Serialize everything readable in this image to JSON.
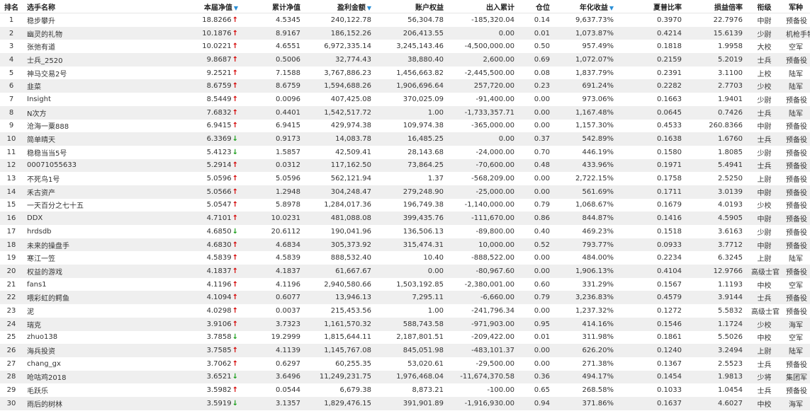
{
  "columns": [
    {
      "key": "rank",
      "label": "排名",
      "sort": false
    },
    {
      "key": "name",
      "label": "选手名称",
      "sort": false
    },
    {
      "key": "nav",
      "label": "本届净值",
      "sort": true
    },
    {
      "key": "cum_nav",
      "label": "累计净值",
      "sort": false
    },
    {
      "key": "profit",
      "label": "盈利金额",
      "sort": true
    },
    {
      "key": "equity",
      "label": "账户权益",
      "sort": false
    },
    {
      "key": "flow",
      "label": "出入累计",
      "sort": false
    },
    {
      "key": "position",
      "label": "仓位",
      "sort": false
    },
    {
      "key": "annual",
      "label": "年化收益",
      "sort": true
    },
    {
      "key": "sharpe",
      "label": "夏普比率",
      "sort": false
    },
    {
      "key": "pl_ratio",
      "label": "损益倍率",
      "sort": false
    },
    {
      "key": "rank_title",
      "label": "衔级",
      "sort": false
    },
    {
      "key": "branch",
      "label": "军种",
      "sort": false
    }
  ],
  "colors": {
    "up": "#d40000",
    "down": "#1a9e1a",
    "sort": "#2b8fd6",
    "stripe": "#efefef"
  },
  "rows": [
    {
      "rank": "1",
      "name": "稳步攀升",
      "nav": "18.8266",
      "dir": "up",
      "cum_nav": "4.5345",
      "profit": "240,122.78",
      "equity": "56,304.78",
      "flow": "-185,320.04",
      "position": "0.14",
      "annual": "9,637.73%",
      "sharpe": "0.3970",
      "pl_ratio": "22.7976",
      "rank_title": "中尉",
      "branch": "预备役"
    },
    {
      "rank": "2",
      "name": "幽灵的礼物",
      "nav": "10.1876",
      "dir": "up",
      "cum_nav": "8.9167",
      "profit": "186,152.26",
      "equity": "206,413.55",
      "flow": "0.00",
      "position": "0.01",
      "annual": "1,073.87%",
      "sharpe": "0.4214",
      "pl_ratio": "15.6139",
      "rank_title": "少尉",
      "branch": "机枪手特战营"
    },
    {
      "rank": "3",
      "name": "张弛有道",
      "nav": "10.0221",
      "dir": "up",
      "cum_nav": "4.6551",
      "profit": "6,972,335.14",
      "equity": "3,245,143.46",
      "flow": "-4,500,000.00",
      "position": "0.50",
      "annual": "957.49%",
      "sharpe": "0.1818",
      "pl_ratio": "1.9958",
      "rank_title": "大校",
      "branch": "空军"
    },
    {
      "rank": "4",
      "name": "士兵_2520",
      "nav": "9.8687",
      "dir": "up",
      "cum_nav": "0.5006",
      "profit": "32,774.43",
      "equity": "38,880.40",
      "flow": "2,600.00",
      "position": "0.69",
      "annual": "1,072.07%",
      "sharpe": "0.2159",
      "pl_ratio": "5.2019",
      "rank_title": "士兵",
      "branch": "预备役"
    },
    {
      "rank": "5",
      "name": "神马交易2号",
      "nav": "9.2521",
      "dir": "up",
      "cum_nav": "7.1588",
      "profit": "3,767,886.23",
      "equity": "1,456,663.82",
      "flow": "-2,445,500.00",
      "position": "0.08",
      "annual": "1,837.79%",
      "sharpe": "0.2391",
      "pl_ratio": "3.1100",
      "rank_title": "上校",
      "branch": "陆军"
    },
    {
      "rank": "6",
      "name": "韭菜",
      "nav": "8.6759",
      "dir": "up",
      "cum_nav": "8.6759",
      "profit": "1,594,688.26",
      "equity": "1,906,696.64",
      "flow": "257,720.00",
      "position": "0.23",
      "annual": "691.24%",
      "sharpe": "0.2282",
      "pl_ratio": "2.7703",
      "rank_title": "少校",
      "branch": "陆军"
    },
    {
      "rank": "7",
      "name": "Insight",
      "nav": "8.5449",
      "dir": "up",
      "cum_nav": "0.0096",
      "profit": "407,425.08",
      "equity": "370,025.09",
      "flow": "-91,400.00",
      "position": "0.00",
      "annual": "973.06%",
      "sharpe": "0.1663",
      "pl_ratio": "1.9401",
      "rank_title": "少尉",
      "branch": "预备役"
    },
    {
      "rank": "8",
      "name": "N次方",
      "nav": "7.6832",
      "dir": "up",
      "cum_nav": "0.4401",
      "profit": "1,542,517.72",
      "equity": "1.00",
      "flow": "-1,733,357.71",
      "position": "0.00",
      "annual": "1,167.48%",
      "sharpe": "0.0645",
      "pl_ratio": "0.7426",
      "rank_title": "士兵",
      "branch": "陆军"
    },
    {
      "rank": "9",
      "name": "沧海一粟888",
      "nav": "6.9415",
      "dir": "up",
      "cum_nav": "6.9415",
      "profit": "429,974.38",
      "equity": "109,974.38",
      "flow": "-365,000.00",
      "position": "0.00",
      "annual": "1,157.30%",
      "sharpe": "0.4533",
      "pl_ratio": "260.8366",
      "rank_title": "中尉",
      "branch": "预备役"
    },
    {
      "rank": "10",
      "name": "简单晴天",
      "nav": "6.3369",
      "dir": "down",
      "cum_nav": "0.9173",
      "profit": "14,083.78",
      "equity": "16,485.25",
      "flow": "0.00",
      "position": "0.37",
      "annual": "542.89%",
      "sharpe": "0.1638",
      "pl_ratio": "1.6760",
      "rank_title": "士兵",
      "branch": "预备役"
    },
    {
      "rank": "11",
      "name": "稳稳当当5号",
      "nav": "5.4123",
      "dir": "down",
      "cum_nav": "1.5857",
      "profit": "42,509.41",
      "equity": "28,143.68",
      "flow": "-24,000.00",
      "position": "0.70",
      "annual": "446.19%",
      "sharpe": "0.1580",
      "pl_ratio": "1.8085",
      "rank_title": "少尉",
      "branch": "预备役"
    },
    {
      "rank": "12",
      "name": "00071055633",
      "nav": "5.2914",
      "dir": "up",
      "cum_nav": "0.0312",
      "profit": "117,162.50",
      "equity": "73,864.25",
      "flow": "-70,600.00",
      "position": "0.48",
      "annual": "433.96%",
      "sharpe": "0.1971",
      "pl_ratio": "5.4941",
      "rank_title": "士兵",
      "branch": "预备役"
    },
    {
      "rank": "13",
      "name": "不死鸟1号",
      "nav": "5.0596",
      "dir": "up",
      "cum_nav": "5.0596",
      "profit": "562,121.94",
      "equity": "1.37",
      "flow": "-568,209.00",
      "position": "0.00",
      "annual": "2,722.15%",
      "sharpe": "0.1758",
      "pl_ratio": "2.5250",
      "rank_title": "上尉",
      "branch": "预备役"
    },
    {
      "rank": "14",
      "name": "禾古资产",
      "nav": "5.0566",
      "dir": "up",
      "cum_nav": "1.2948",
      "profit": "304,248.47",
      "equity": "279,248.90",
      "flow": "-25,000.00",
      "position": "0.00",
      "annual": "561.69%",
      "sharpe": "0.1711",
      "pl_ratio": "3.0139",
      "rank_title": "中尉",
      "branch": "预备役"
    },
    {
      "rank": "15",
      "name": "一天百分之七十五",
      "nav": "5.0547",
      "dir": "up",
      "cum_nav": "5.8978",
      "profit": "1,284,017.36",
      "equity": "196,749.38",
      "flow": "-1,140,000.00",
      "position": "0.79",
      "annual": "1,068.67%",
      "sharpe": "0.1679",
      "pl_ratio": "4.0193",
      "rank_title": "少校",
      "branch": "预备役"
    },
    {
      "rank": "16",
      "name": "DDX",
      "nav": "4.7101",
      "dir": "up",
      "cum_nav": "10.0231",
      "profit": "481,088.08",
      "equity": "399,435.76",
      "flow": "-111,670.00",
      "position": "0.86",
      "annual": "844.87%",
      "sharpe": "0.1416",
      "pl_ratio": "4.5905",
      "rank_title": "中尉",
      "branch": "预备役"
    },
    {
      "rank": "17",
      "name": "hrdsdb",
      "nav": "4.6850",
      "dir": "down",
      "cum_nav": "20.6112",
      "profit": "190,041.96",
      "equity": "136,506.13",
      "flow": "-89,800.00",
      "position": "0.40",
      "annual": "469.23%",
      "sharpe": "0.1518",
      "pl_ratio": "3.6163",
      "rank_title": "少尉",
      "branch": "预备役"
    },
    {
      "rank": "18",
      "name": "未来的操盘手",
      "nav": "4.6830",
      "dir": "up",
      "cum_nav": "4.6834",
      "profit": "305,373.92",
      "equity": "315,474.31",
      "flow": "10,000.00",
      "position": "0.52",
      "annual": "793.77%",
      "sharpe": "0.0933",
      "pl_ratio": "3.7712",
      "rank_title": "中尉",
      "branch": "预备役"
    },
    {
      "rank": "19",
      "name": "寒江一笠",
      "nav": "4.5839",
      "dir": "up",
      "cum_nav": "4.5839",
      "profit": "888,532.40",
      "equity": "10.40",
      "flow": "-888,522.00",
      "position": "0.00",
      "annual": "484.00%",
      "sharpe": "0.2234",
      "pl_ratio": "6.3245",
      "rank_title": "上尉",
      "branch": "陆军"
    },
    {
      "rank": "20",
      "name": "权益的游戏",
      "nav": "4.1837",
      "dir": "up",
      "cum_nav": "4.1837",
      "profit": "61,667.67",
      "equity": "0.00",
      "flow": "-80,967.60",
      "position": "0.00",
      "annual": "1,906.13%",
      "sharpe": "0.4104",
      "pl_ratio": "12.9766",
      "rank_title": "高级士官",
      "branch": "预备役"
    },
    {
      "rank": "21",
      "name": "fans1",
      "nav": "4.1196",
      "dir": "up",
      "cum_nav": "4.1196",
      "profit": "2,940,580.66",
      "equity": "1,503,192.85",
      "flow": "-2,380,001.00",
      "position": "0.60",
      "annual": "331.29%",
      "sharpe": "0.1567",
      "pl_ratio": "1.1193",
      "rank_title": "中校",
      "branch": "空军"
    },
    {
      "rank": "22",
      "name": "喂彩虹的鳄鱼",
      "nav": "4.1094",
      "dir": "up",
      "cum_nav": "0.6077",
      "profit": "13,946.13",
      "equity": "7,295.11",
      "flow": "-6,660.00",
      "position": "0.79",
      "annual": "3,236.83%",
      "sharpe": "0.4579",
      "pl_ratio": "3.9144",
      "rank_title": "士兵",
      "branch": "预备役"
    },
    {
      "rank": "23",
      "name": "泥",
      "nav": "4.0298",
      "dir": "up",
      "cum_nav": "0.0037",
      "profit": "215,453.56",
      "equity": "1.00",
      "flow": "-241,796.34",
      "position": "0.00",
      "annual": "1,237.32%",
      "sharpe": "0.1272",
      "pl_ratio": "5.5832",
      "rank_title": "高级士官",
      "branch": "预备役"
    },
    {
      "rank": "24",
      "name": "瑞克",
      "nav": "3.9106",
      "dir": "up",
      "cum_nav": "3.7323",
      "profit": "1,161,570.32",
      "equity": "588,743.58",
      "flow": "-971,903.00",
      "position": "0.95",
      "annual": "414.16%",
      "sharpe": "0.1546",
      "pl_ratio": "1.1724",
      "rank_title": "少校",
      "branch": "海军"
    },
    {
      "rank": "25",
      "name": "zhuo138",
      "nav": "3.7858",
      "dir": "down",
      "cum_nav": "19.2999",
      "profit": "1,815,644.11",
      "equity": "2,187,801.51",
      "flow": "-209,422.00",
      "position": "0.01",
      "annual": "311.98%",
      "sharpe": "0.1861",
      "pl_ratio": "5.5026",
      "rank_title": "中校",
      "branch": "空军"
    },
    {
      "rank": "26",
      "name": "海兵投资",
      "nav": "3.7585",
      "dir": "up",
      "cum_nav": "4.1139",
      "profit": "1,145,767.08",
      "equity": "845,051.98",
      "flow": "-483,101.37",
      "position": "0.00",
      "annual": "626.20%",
      "sharpe": "0.1240",
      "pl_ratio": "3.2494",
      "rank_title": "上尉",
      "branch": "陆军"
    },
    {
      "rank": "27",
      "name": "chang_gx",
      "nav": "3.7062",
      "dir": "up",
      "cum_nav": "0.6297",
      "profit": "60,255.35",
      "equity": "53,020.61",
      "flow": "-29,500.00",
      "position": "0.00",
      "annual": "271.38%",
      "sharpe": "0.1367",
      "pl_ratio": "2.5523",
      "rank_title": "士兵",
      "branch": "预备役"
    },
    {
      "rank": "28",
      "name": "呛咕鸡2018",
      "nav": "3.6521",
      "dir": "down",
      "cum_nav": "3.6496",
      "profit": "11,249,231.75",
      "equity": "1,976,468.04",
      "flow": "-11,674,370.58",
      "position": "0.36",
      "annual": "494.17%",
      "sharpe": "0.1454",
      "pl_ratio": "1.9813",
      "rank_title": "少将",
      "branch": "集团军"
    },
    {
      "rank": "29",
      "name": "毛跃乐",
      "nav": "3.5982",
      "dir": "up",
      "cum_nav": "0.0544",
      "profit": "6,679.38",
      "equity": "8,873.21",
      "flow": "-100.00",
      "position": "0.65",
      "annual": "268.58%",
      "sharpe": "0.1033",
      "pl_ratio": "1.0454",
      "rank_title": "士兵",
      "branch": "预备役"
    },
    {
      "rank": "30",
      "name": "雨后的树林",
      "nav": "3.5919",
      "dir": "down",
      "cum_nav": "3.1357",
      "profit": "1,829,476.15",
      "equity": "391,901.89",
      "flow": "-1,916,930.00",
      "position": "0.94",
      "annual": "371.86%",
      "sharpe": "0.1637",
      "pl_ratio": "4.6027",
      "rank_title": "中校",
      "branch": "海军"
    }
  ]
}
